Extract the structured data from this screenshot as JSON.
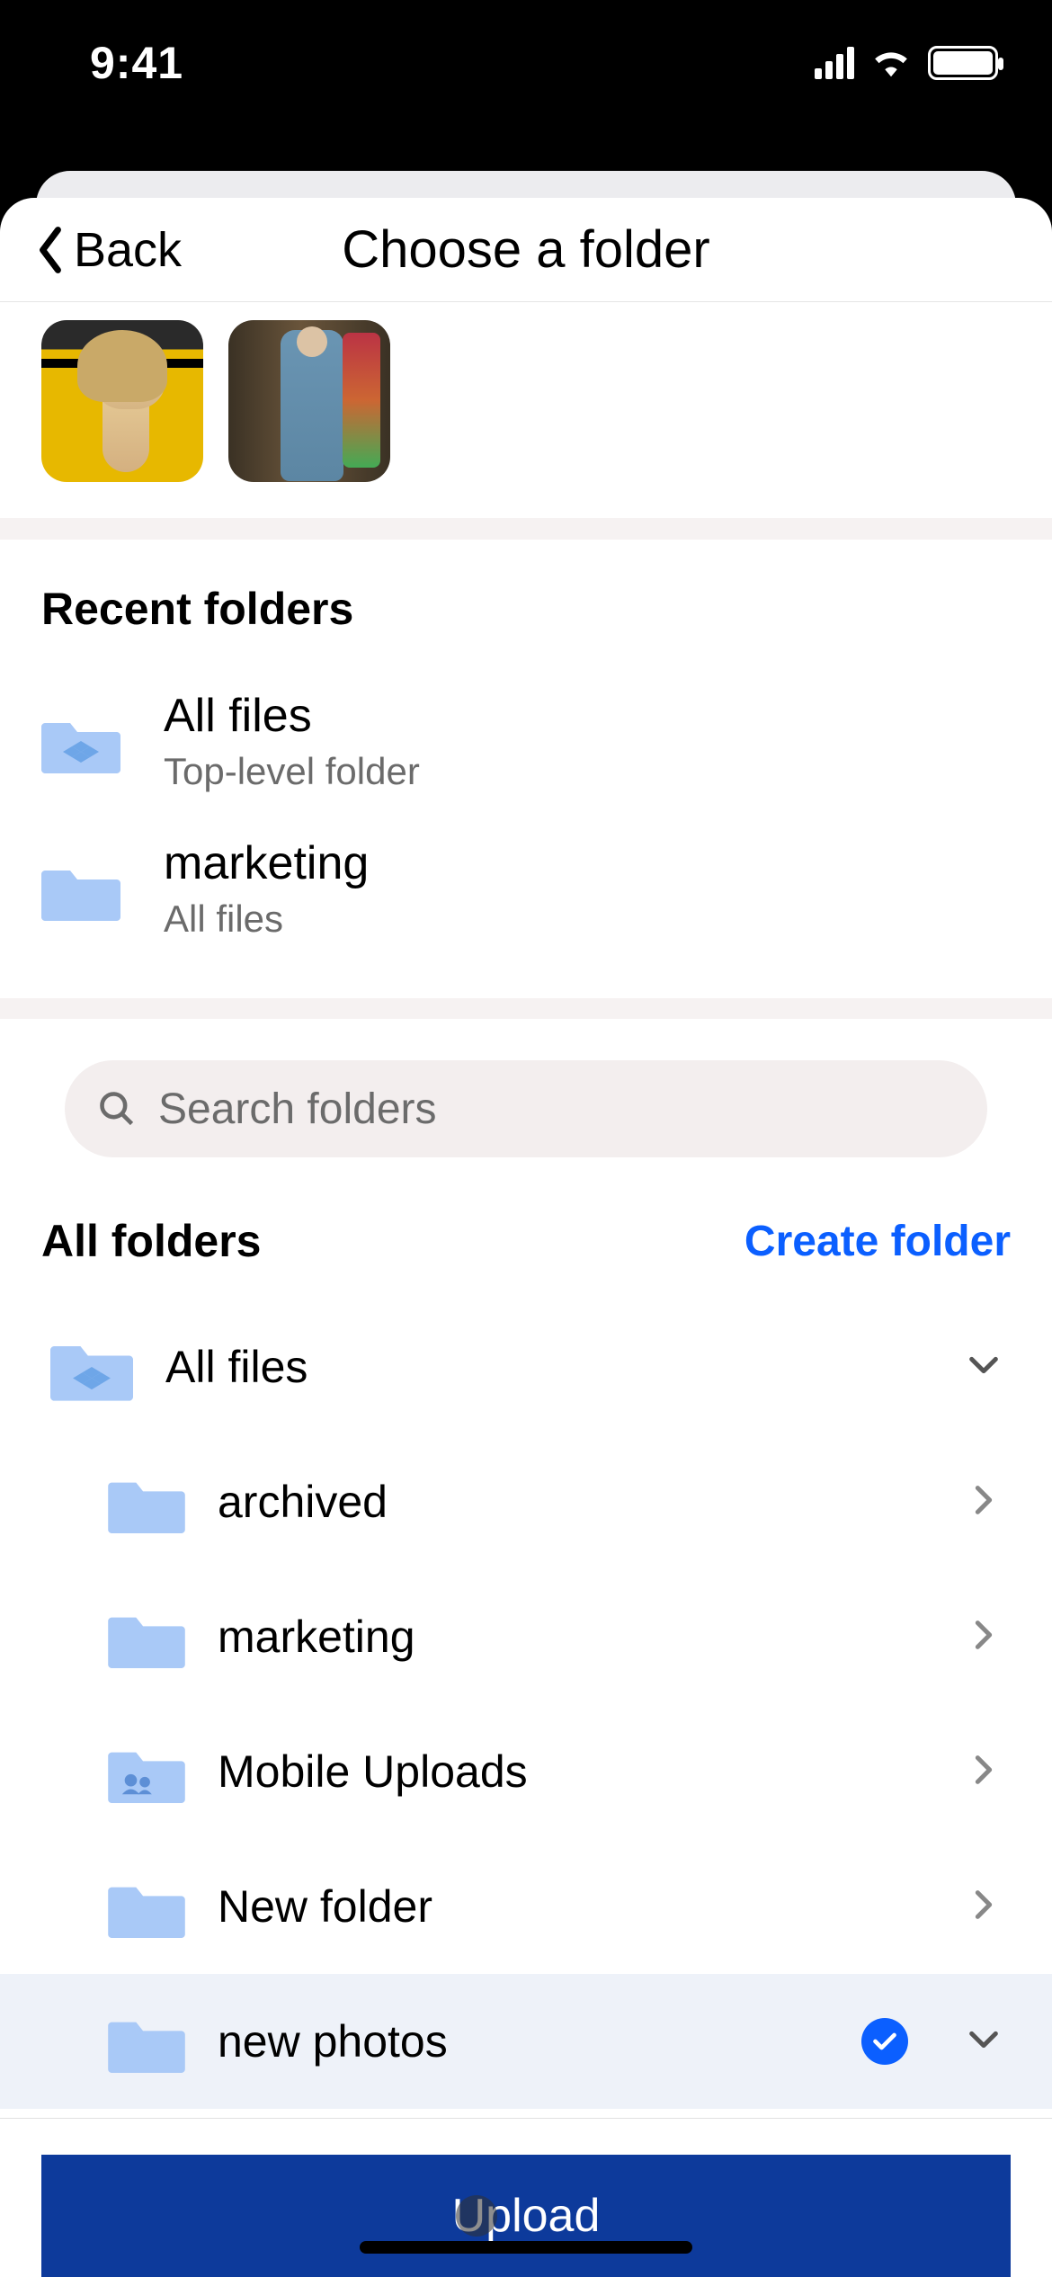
{
  "status": {
    "time": "9:41"
  },
  "header": {
    "back_label": "Back",
    "title": "Choose a folder"
  },
  "recent": {
    "heading": "Recent folders",
    "items": [
      {
        "name": "All files",
        "sub": "Top-level folder",
        "dropbox": true
      },
      {
        "name": "marketing",
        "sub": "All files",
        "dropbox": false
      }
    ]
  },
  "search": {
    "placeholder": "Search folders"
  },
  "folders": {
    "heading": "All folders",
    "create_label": "Create folder",
    "root": {
      "name": "All files"
    },
    "children": [
      {
        "name": "archived",
        "shared": false
      },
      {
        "name": "marketing",
        "shared": false
      },
      {
        "name": "Mobile Uploads",
        "shared": true
      },
      {
        "name": "New folder",
        "shared": false
      },
      {
        "name": "new photos",
        "shared": false,
        "selected": true
      }
    ]
  },
  "upload": {
    "label": "Upload"
  },
  "colors": {
    "accent": "#0b5fff",
    "primary_btn": "#0d3a9b",
    "folder": "#a9c9f7"
  }
}
